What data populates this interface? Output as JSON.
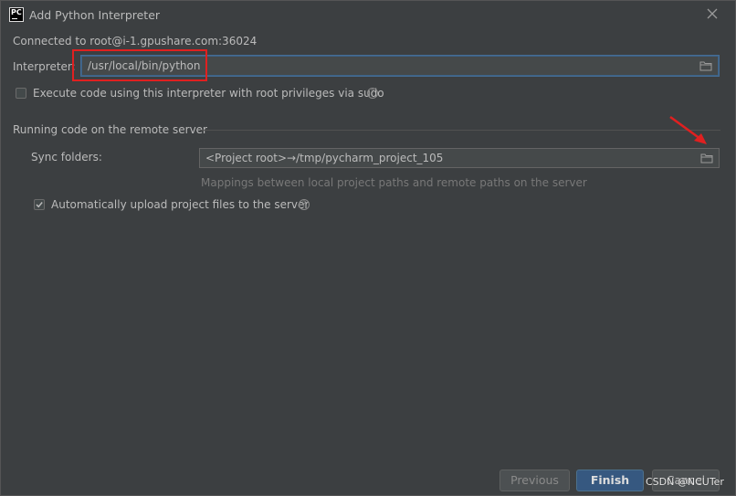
{
  "window": {
    "title": "Add Python Interpreter"
  },
  "connection": {
    "text": "Connected to root@i-1.gpushare.com:36024"
  },
  "interpreter": {
    "label": "Interpreter:",
    "value": "/usr/local/bin/python"
  },
  "sudo_option": {
    "label": "Execute code using this interpreter with root privileges via sudo",
    "checked": false
  },
  "remote_section": {
    "title": "Running code on the remote server",
    "sync_label": "Sync folders:",
    "sync_value": "<Project root>→/tmp/pycharm_project_105",
    "hint": "Mappings between local project paths and remote paths on the server",
    "auto_upload_label": "Automatically upload project files to the server",
    "auto_upload_checked": true
  },
  "buttons": {
    "previous": "Previous",
    "finish": "Finish",
    "cancel": "Cancel"
  },
  "icons": {
    "app": "pycharm-icon",
    "close": "close-icon",
    "folder": "folder-icon",
    "help": "help-icon",
    "arrow": "red-arrow-annotation"
  },
  "colors": {
    "background": "#3c3f41",
    "accent": "#365880",
    "annotation": "#e02020"
  },
  "watermark": {
    "text": "CSDN @NCUTer"
  }
}
